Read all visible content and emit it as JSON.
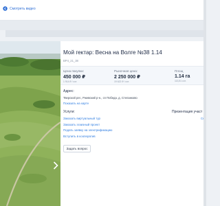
{
  "nav": {
    "back_label": "Смотреть видео",
    "back_icon": "arrow-left-icon"
  },
  "listing": {
    "title": "Мой гектар: Весна на Волге №38 1.14",
    "code": "ВР4_21_38"
  },
  "prices": [
    {
      "label": "Цена покупки:",
      "value": "450 000 ₽",
      "sub": "1 914 ₽ / сот."
    },
    {
      "label": "Рыночная цена:",
      "value": "2 250 000 ₽",
      "sub": "19 622 ₽ / сот."
    },
    {
      "label": "Площ",
      "value": "1.14 га",
      "sub": "113,51 сот."
    }
  ],
  "address": {
    "label": "Адрес:",
    "text": "Тверской рег., Ржевский р-н., сп Победа, д. Степанково",
    "map_link": "Показать на карте"
  },
  "services": {
    "label": "Услуги:",
    "links": [
      "Заказать виртуальный тур",
      "Заказать эскизный проект",
      "Подать заявку на электрификацию",
      "Вступить в кооператив"
    ]
  },
  "presentation": {
    "label": "Презентация участ",
    "link": "Ски"
  },
  "actions": {
    "ask_label": "Задать вопрос"
  },
  "colors": {
    "accent": "#2f7de1",
    "text": "#24304a",
    "panel": "#f4f7fb"
  }
}
